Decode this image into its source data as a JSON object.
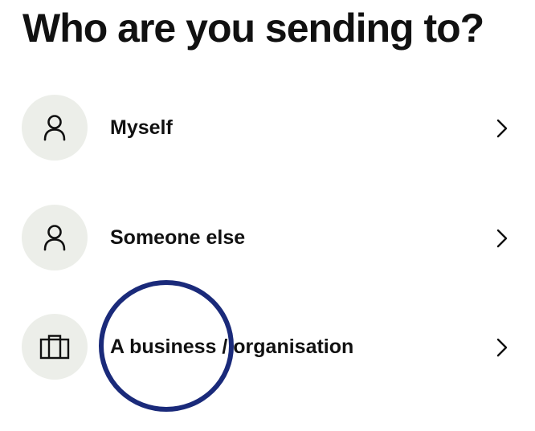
{
  "page": {
    "title": "Who are you sending to?"
  },
  "options": [
    {
      "label": "Myself",
      "icon": "person-icon"
    },
    {
      "label": "Someone else",
      "icon": "person-icon"
    },
    {
      "label": "A business / organisation",
      "icon": "briefcase-icon"
    }
  ],
  "colors": {
    "text": "#111111",
    "icon_background": "#eceee9",
    "annotation": "#1a2a7a"
  }
}
